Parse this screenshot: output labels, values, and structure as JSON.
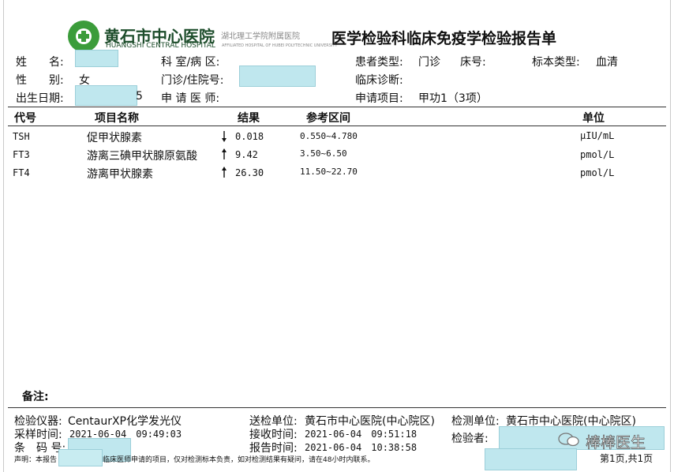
{
  "header": {
    "hospital_cn": "黄石市中心医院",
    "hospital_en": "HUANGSHI CENTRAL HOSPITAL",
    "affiliation_cn": "湖北理工学院附属医院",
    "affiliation_en": "AFFILIATED HOSPITAL OF HUBEI POLYTECHNIC UNIVERSITY",
    "report_title": "医学检验科临床免疫学检验报告单"
  },
  "patient": {
    "name_label": "姓　　名:",
    "dept_label": "科 室/病 区:",
    "patient_type_label": "患者类型:",
    "patient_type_value": "门诊",
    "bed_label": "床号:",
    "sample_type_label": "标本类型:",
    "sample_type_value": "血清",
    "sex_label": "性　　别:",
    "sex_value": "女",
    "clinic_no_label": "门诊/住院号:",
    "diagnosis_label": "临床诊断:",
    "dob_label": "出生日期:",
    "dob_suffix": "5",
    "doctor_label": "申 请 医 师:",
    "request_label": "申请项目:",
    "request_value": "甲功1（3项）"
  },
  "table": {
    "headers": [
      "代号",
      "项目名称",
      "结果",
      "参考区间",
      "单位"
    ],
    "rows": [
      {
        "code": "TSH",
        "name": "促甲状腺素",
        "flag": "down",
        "result": "0.018",
        "range": "0.550~4.780",
        "unit": "μIU/mL"
      },
      {
        "code": "FT3",
        "name": "游离三碘甲状腺原氨酸",
        "flag": "up",
        "result": "9.42",
        "range": "3.50~6.50",
        "unit": "pmol/L"
      },
      {
        "code": "FT4",
        "name": "游离甲状腺素",
        "flag": "up",
        "result": "26.30",
        "range": "11.50~22.70",
        "unit": "pmol/L"
      }
    ]
  },
  "remarks_label": "备注:",
  "footer": {
    "instrument_label": "检验仪器:",
    "instrument_value": "CentaurXP化学发光仪",
    "sample_time_label": "采样时间:",
    "sample_time_value": "2021-06-04　09:49:03",
    "barcode_label": "条　码 号:",
    "send_unit_label": "送检单位:",
    "send_unit_value": "黄石市中心医院(中心院区)",
    "receive_time_label": "接收时间:",
    "receive_time_value": "2021-06-04　09:51:18",
    "report_time_label": "报告时间:",
    "report_time_value": "2021-06-04　10:38:58",
    "test_unit_label": "检测单位:",
    "test_unit_value": "黄石市中心医院(中心院区)",
    "tester_label": "检验者:",
    "disclaimer_a": "声明：本报告",
    "disclaimer_b": "临床医师申请的项目，仅对检测标本负责，如对检测结果有疑问，请在48小时内联系。",
    "page": "第1页,共1页",
    "watermark": "棒棒医生"
  }
}
